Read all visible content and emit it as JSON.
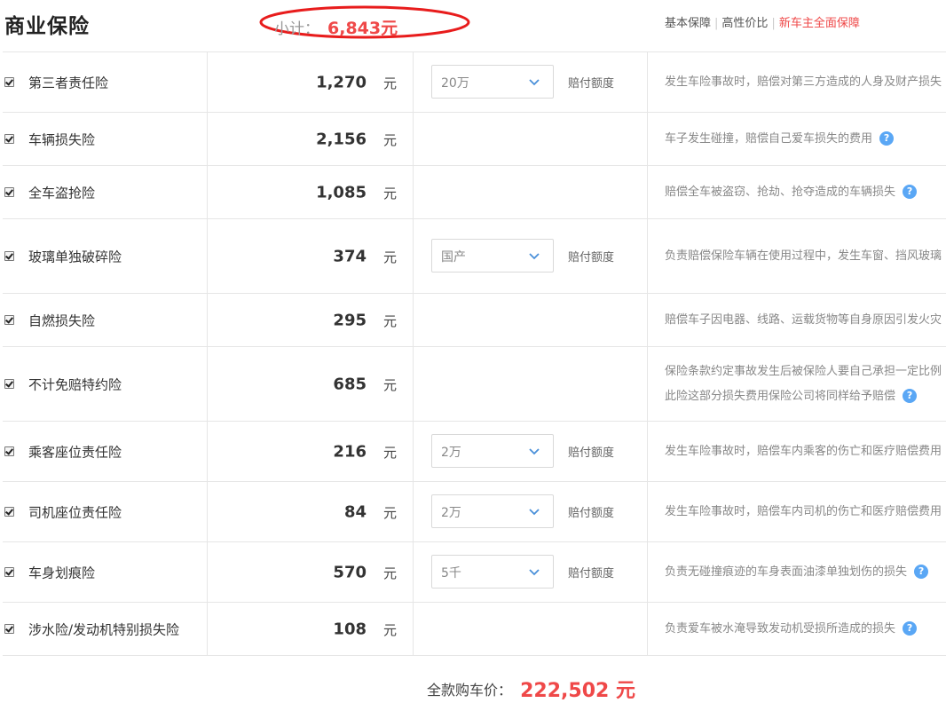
{
  "header": {
    "title": "商业保险",
    "subtotal_label": "小计：",
    "subtotal_value": "6,843元",
    "links": [
      "基本保障",
      "高性价比",
      "新车主全面保障"
    ]
  },
  "rows": [
    {
      "name": "第三者责任险",
      "price": "1,270",
      "unit": "元",
      "select": "20万",
      "limit_label": "赔付额度",
      "desc": "发生车险事故时，赔偿对第三方造成的人身及财产损失",
      "checked": true
    },
    {
      "name": "车辆损失险",
      "price": "2,156",
      "unit": "元",
      "desc": "车子发生碰撞，赔偿自己爱车损失的费用",
      "checked": true
    },
    {
      "name": "全车盗抢险",
      "price": "1,085",
      "unit": "元",
      "desc": "赔偿全车被盗窃、抢劫、抢夺造成的车辆损失",
      "checked": true
    },
    {
      "name": "玻璃单独破碎险",
      "price": "374",
      "unit": "元",
      "select": "国产",
      "limit_label": "赔付额度",
      "desc": "负责赔偿保险车辆在使用过程中，发生车窗、挡风玻璃",
      "checked": true
    },
    {
      "name": "自燃损失险",
      "price": "295",
      "unit": "元",
      "desc": "赔偿车子因电器、线路、运载货物等自身原因引发火灾",
      "checked": true
    },
    {
      "name": "不计免赔特约险",
      "price": "685",
      "unit": "元",
      "desc": "保险条款约定事故发生后被保险人要自己承担一定比例",
      "desc2": "此险这部分损失费用保险公司将同样给予赔偿",
      "checked": true
    },
    {
      "name": "乘客座位责任险",
      "price": "216",
      "unit": "元",
      "select": "2万",
      "limit_label": "赔付额度",
      "desc": "发生车险事故时，赔偿车内乘客的伤亡和医疗赔偿费用",
      "checked": true
    },
    {
      "name": "司机座位责任险",
      "price": "84",
      "unit": "元",
      "select": "2万",
      "limit_label": "赔付额度",
      "desc": "发生车险事故时，赔偿车内司机的伤亡和医疗赔偿费用",
      "checked": true
    },
    {
      "name": "车身划痕险",
      "price": "570",
      "unit": "元",
      "select": "5千",
      "limit_label": "赔付额度",
      "desc": "负责无碰撞痕迹的车身表面油漆单独划伤的损失",
      "checked": true
    },
    {
      "name": "涉水险/发动机特别损失险",
      "price": "108",
      "unit": "元",
      "desc": "负责爱车被水淹导致发动机受损所造成的损失",
      "checked": true
    }
  ],
  "footer": {
    "total_label": "全款购车价：",
    "total_value": "222,502 元"
  },
  "colors": {
    "accent_red": "#ef4848",
    "help_blue": "#5aa7f5",
    "border": "#e6e6e6"
  },
  "icons": {
    "checkbox": "checked-checkbox-icon",
    "dropdown": "chevron-down-icon",
    "help": "question-circle-icon"
  }
}
